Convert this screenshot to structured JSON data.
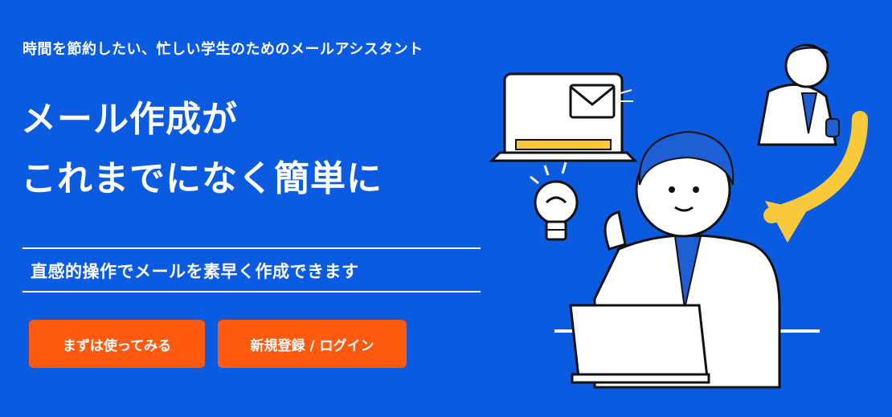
{
  "hero": {
    "tagline": "時間を節約したい、忙しい学生のためのメールアシスタント",
    "headline_line1": "メール作成が",
    "headline_line2": "これまでになく簡単に",
    "subheadline": "直感的操作でメールを素早く作成できます"
  },
  "buttons": {
    "try_label": "まずは使ってみる",
    "login_label": "新規登録 / ログイン"
  },
  "colors": {
    "background": "#0B5BE0",
    "button": "#FF5A0F",
    "accent_yellow": "#F7C93B",
    "tie": "#1F5FD6"
  },
  "illustration": {
    "icons": [
      "laptop-icon",
      "envelope-icon",
      "lightbulb-icon",
      "arrow-icon"
    ]
  }
}
